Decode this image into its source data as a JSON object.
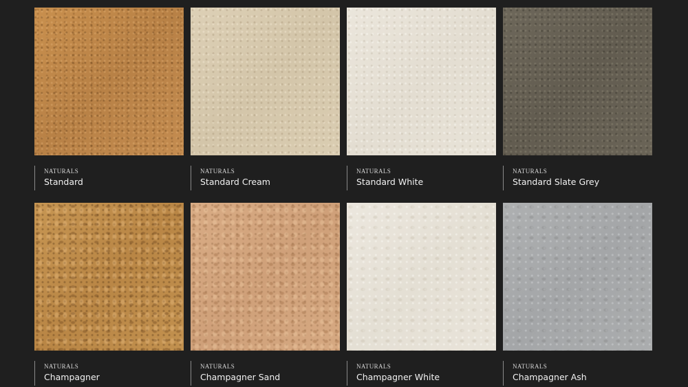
{
  "colors": {
    "background": "#1f1f1f",
    "caption_rule": "#8a8a8a",
    "caption_text": "#f2f2f2"
  },
  "swatches": [
    {
      "collection": "NATURALS",
      "name": "Standard",
      "color": "#c08a4c"
    },
    {
      "collection": "NATURALS",
      "name": "Standard Cream",
      "color": "#d8cbb0"
    },
    {
      "collection": "NATURALS",
      "name": "Standard White",
      "color": "#e7e2d7"
    },
    {
      "collection": "NATURALS",
      "name": "Standard Slate Grey",
      "color": "#686256"
    },
    {
      "collection": "NATURALS",
      "name": "Champagner",
      "color": "#c08f4e"
    },
    {
      "collection": "NATURALS",
      "name": "Champagner Sand",
      "color": "#d4a67f"
    },
    {
      "collection": "NATURALS",
      "name": "Champagner White",
      "color": "#e8e3d9"
    },
    {
      "collection": "NATURALS",
      "name": "Champagner Ash",
      "color": "#aaacad"
    }
  ]
}
